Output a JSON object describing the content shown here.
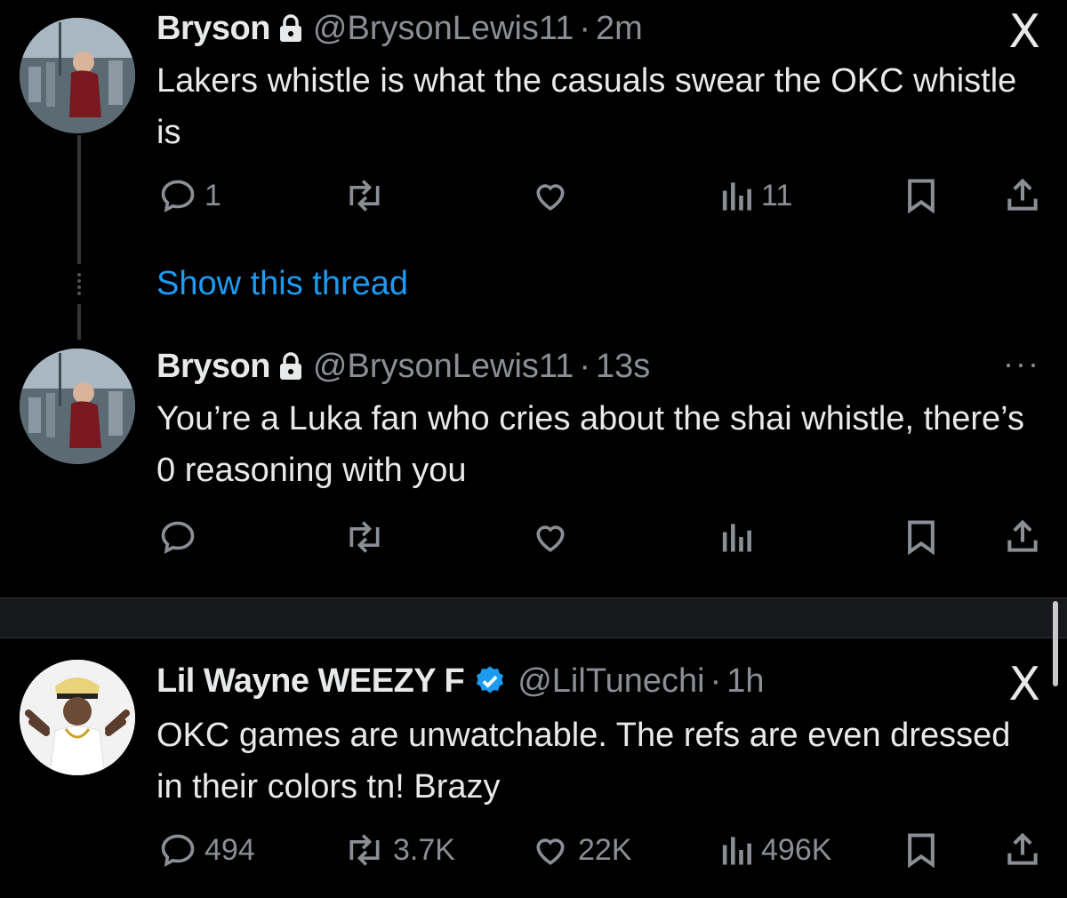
{
  "tweets": [
    {
      "name": "Bryson",
      "handle": "@BrysonLewis11",
      "time_sep": "·",
      "time": "2m",
      "text": "Lakers whistle is what the casuals swear the OKC whistle is",
      "locked": true,
      "corner_icon": "x-logo-icon",
      "corner_text": "X",
      "replies": "1",
      "retweets": "",
      "likes": "",
      "views": "11"
    },
    {
      "name": "Bryson",
      "handle": "@BrysonLewis11",
      "time_sep": "·",
      "time": "13s",
      "text": "You’re a Luka fan who cries about the shai whistle, there’s 0 reasoning with you",
      "locked": true,
      "corner_icon": "more-icon",
      "corner_text": "···",
      "replies": "",
      "retweets": "",
      "likes": "",
      "views": ""
    },
    {
      "name": "Lil Wayne WEEZY F",
      "handle": "@LilTunechi",
      "time_sep": "·",
      "time": "1h",
      "text": "OKC games are unwatchable. The refs are even dressed in their colors tn!  Brazy",
      "verified": true,
      "corner_icon": "x-logo-icon",
      "corner_text": "X",
      "replies": "494",
      "retweets": "3.7K",
      "likes": "22K",
      "views": "496K"
    }
  ],
  "show_thread": "Show this thread",
  "colors": {
    "background": "#000000",
    "text": "#e7e9ea",
    "secondary": "#8b8f94",
    "link": "#1d9bf0",
    "verified": "#1d9bf0"
  }
}
